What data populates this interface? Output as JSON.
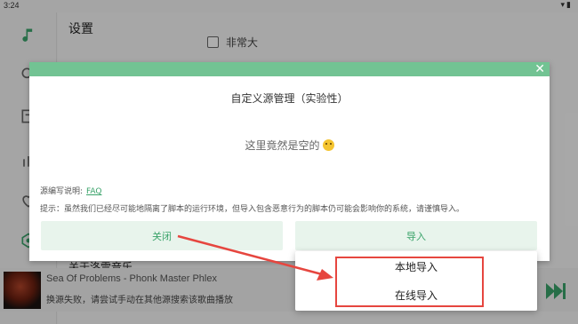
{
  "status_bar": {
    "time": "3:24",
    "icons": "wifi-icon battery-icon"
  },
  "sidebar": {
    "icons": [
      "music-note-icon",
      "search-icon",
      "list-icon",
      "chart-icon",
      "heart-icon",
      "settings-icon",
      "power-icon"
    ]
  },
  "settings": {
    "title": "设置",
    "checkbox_label": "非常大",
    "section_label": "关于洛雪音乐"
  },
  "player": {
    "song_title": "Sea Of Problems - Phonk Master Phlex",
    "status": "换源失败，请尝试手动在其他源搜索该歌曲播放"
  },
  "dialog": {
    "title": "自定义源管理（实验性）",
    "empty_text": "这里竟然是空的",
    "note_label": "源编写说明:",
    "note_link": "FAQ",
    "tip": "提示：虽然我们已经尽可能地隔离了脚本的运行环境，但导入包含恶意行为的脚本仍可能会影响你的系统，请谨慎导入。",
    "close_button": "关闭",
    "import_button": "导入"
  },
  "import_menu": {
    "items": [
      "本地导入",
      "在线导入"
    ]
  },
  "colors": {
    "accent": "#72c393",
    "accent_text": "#3aa36a",
    "annotation": "#e6463f"
  }
}
